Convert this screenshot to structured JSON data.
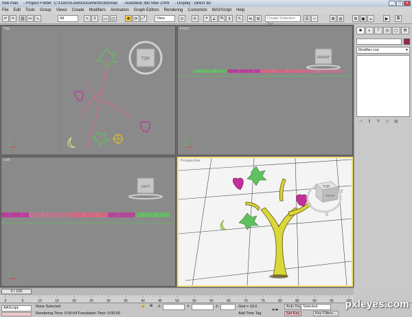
{
  "window": {
    "file": "tree.max",
    "project": "- Project Folder: C:\\Users\\Love\\Documents\\3dsmax",
    "app": "- Autodesk 3ds Max 2009",
    "display": "- Display : Direct 3D"
  },
  "menu": [
    "File",
    "Edit",
    "Tools",
    "Group",
    "Views",
    "Create",
    "Modifiers",
    "Animation",
    "Graph Editors",
    "Rendering",
    "Customize",
    "MAXScript",
    "Help"
  ],
  "toolbar": {
    "filter_value": "All",
    "refcoord_value": "View",
    "selection_set_placeholder": "Create Selection Set"
  },
  "viewports": {
    "top": {
      "label": "Top",
      "cube_label": "TOP"
    },
    "front": {
      "label": "Front",
      "cube_label": "FRONT"
    },
    "left": {
      "label": "Left",
      "cube_label": "LEFT"
    },
    "perspective": {
      "label": "Perspective",
      "cube_label": "TOP",
      "cube_side_label": "FRONT",
      "compass": [
        "E",
        "S"
      ]
    }
  },
  "command_panel": {
    "modifier_list": "Modifier List"
  },
  "timeline": {
    "slider": "0 / 100",
    "ticks": [
      "0",
      "5",
      "10",
      "15",
      "20",
      "25",
      "30",
      "35",
      "40",
      "45",
      "50",
      "55",
      "60",
      "65",
      "70",
      "75",
      "80",
      "85",
      "90",
      "95",
      "100"
    ]
  },
  "status": {
    "maxscript": "AAScript.",
    "selection": "None Selected",
    "rendering_time": "Rendering Time: 0:00:04",
    "translation_time": "Translation Time: 0:00:00",
    "x_label": "X:",
    "y_label": "Y:",
    "z_label": "Z:",
    "grid": "Grid = 10.0",
    "add_time_tag": "Add Time Tag",
    "auto_key": "Auto Key",
    "set_key": "Set Key",
    "selected_value": "Selected",
    "key_filters": "Key Filters..."
  },
  "watermark": "pxleyes.com",
  "colors": {
    "active_border": "#f4e27a",
    "leaf_green": "#5fc05f",
    "heart_pink": "#c0309a",
    "tree_yellow": "#dddd33"
  }
}
